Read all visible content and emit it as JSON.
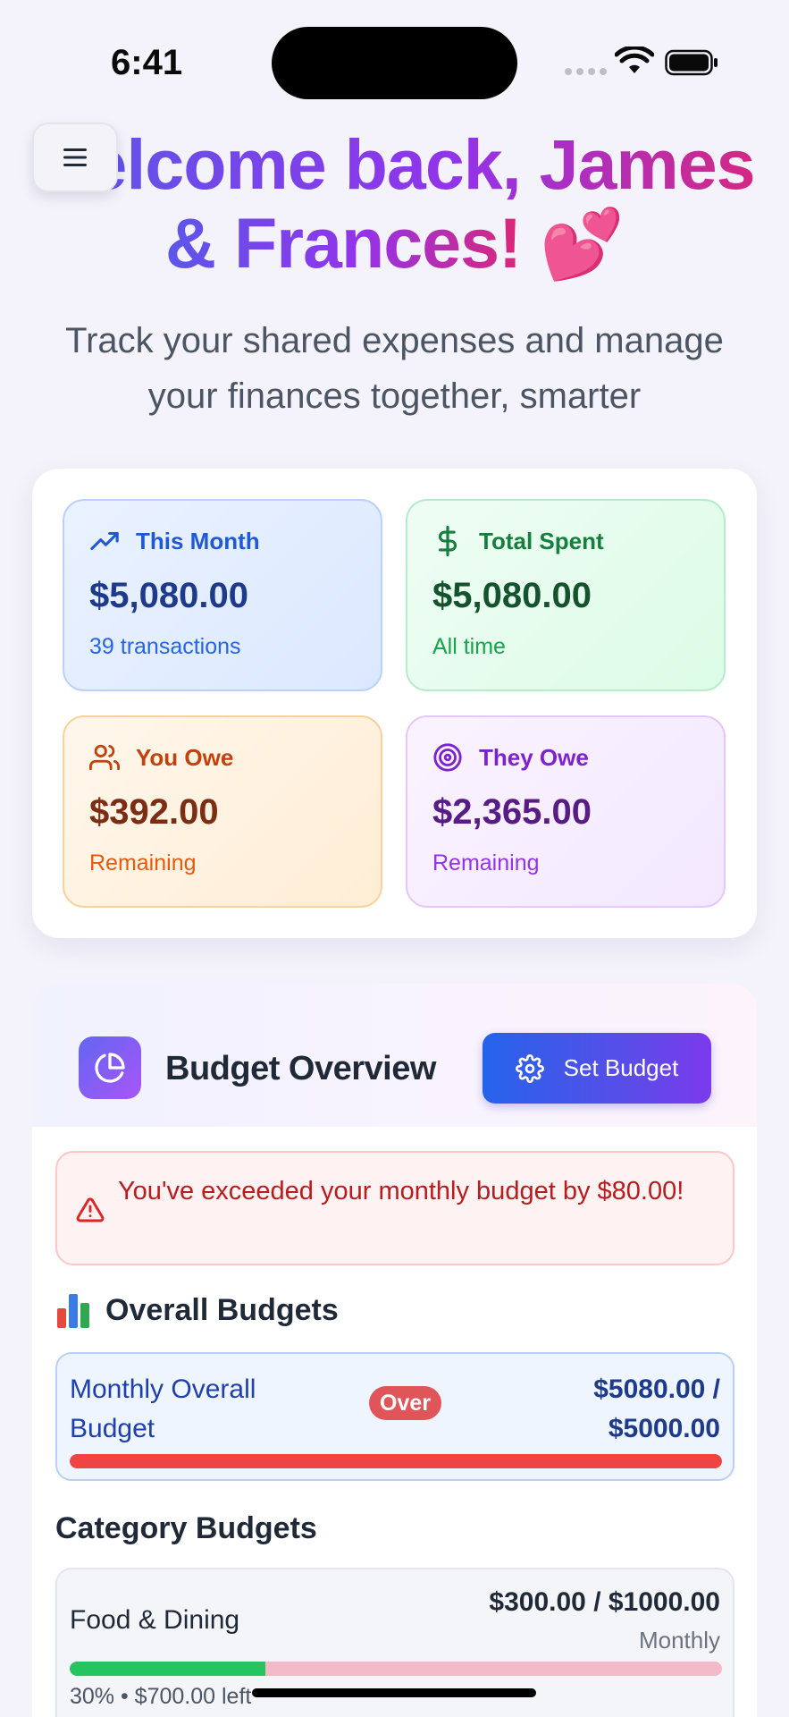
{
  "status_bar": {
    "time": "6:41"
  },
  "hero": {
    "title_line1": "elcome back, James",
    "title_line2": "& Frances!",
    "heart": "💕",
    "subtitle": "Track your shared expenses and manage your finances together, smarter"
  },
  "stats": [
    {
      "label": "This Month",
      "value": "$5,080.00",
      "note": "39 transactions",
      "icon": "trending-up-icon"
    },
    {
      "label": "Total Spent",
      "value": "$5,080.00",
      "note": "All time",
      "icon": "dollar-icon"
    },
    {
      "label": "You Owe",
      "value": "$392.00",
      "note": "Remaining",
      "icon": "users-icon"
    },
    {
      "label": "They Owe",
      "value": "$2,365.00",
      "note": "Remaining",
      "icon": "target-icon"
    }
  ],
  "budget": {
    "title": "Budget Overview",
    "set_budget_label": "Set Budget",
    "alert": "You've exceeded your monthly budget by $80.00!",
    "overall_title": "Overall Budgets",
    "overall": {
      "name": "Monthly Overall Budget",
      "badge": "Over",
      "amount": "$5080.00 / $5000.00",
      "progress": 1.0
    },
    "category_title": "Category Budgets",
    "categories": [
      {
        "name": "Food & Dining",
        "amount": "$300.00 / $1000.00",
        "period": "Monthly",
        "note": "30% • $700.00 left",
        "progress": 0.3
      }
    ]
  },
  "colors": {
    "accent": "#5b57e9",
    "danger": "#ef4444",
    "success": "#22c55e"
  }
}
